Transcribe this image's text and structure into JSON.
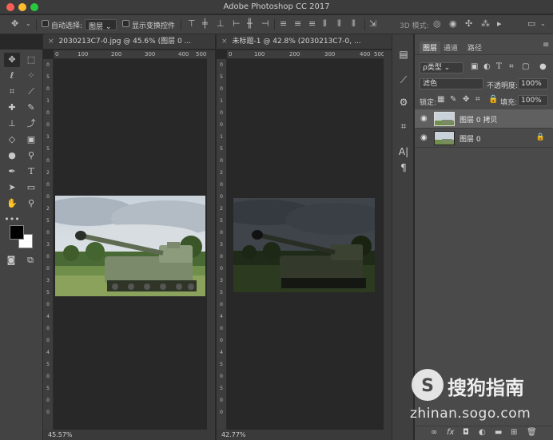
{
  "window": {
    "title": "Adobe Photoshop CC 2017"
  },
  "options_bar": {
    "auto_select_label": "自动选择:",
    "auto_select_value": "图层",
    "show_transform_label": "显示变换控件",
    "mode_3d_label": "3D 模式:"
  },
  "documents": [
    {
      "tab_label": "2030213C7-0.jpg @ 45.6% (图层 0 ...",
      "zoom": "45.57%",
      "ruler_h": [
        "0",
        "100",
        "200",
        "300",
        "400",
        "500"
      ],
      "ruler_v": [
        "0",
        "5",
        "0",
        "1",
        "0",
        "0",
        "1",
        "5",
        "0",
        "2",
        "0",
        "0",
        "2",
        "5",
        "0",
        "3",
        "0",
        "0",
        "3",
        "5",
        "0",
        "4",
        "0",
        "0",
        "4",
        "5",
        "0",
        "5",
        "0",
        "0"
      ]
    },
    {
      "tab_label": "未标题-1 @ 42.8% (2030213C7-0, ...",
      "zoom": "42.77%",
      "ruler_h": [
        "0",
        "100",
        "200",
        "300",
        "400",
        "500"
      ],
      "ruler_v": [
        "0",
        "5",
        "0",
        "1",
        "0",
        "0",
        "1",
        "5",
        "0",
        "2",
        "0",
        "0",
        "2",
        "5",
        "0",
        "3",
        "0",
        "0",
        "3",
        "5",
        "0",
        "4",
        "0",
        "0",
        "4",
        "5",
        "0",
        "5",
        "0",
        "0"
      ]
    }
  ],
  "layers_panel": {
    "tabs": [
      "图层",
      "通道",
      "路径"
    ],
    "filter_kind": "ρ类型",
    "blend_mode": "滤色",
    "opacity_label": "不透明度:",
    "opacity_value": "100%",
    "lock_label": "锁定:",
    "fill_label": "填充:",
    "fill_value": "100%",
    "layers": [
      {
        "name": "图层 0 拷贝",
        "visible": true,
        "selected": true,
        "locked": false
      },
      {
        "name": "图层 0",
        "visible": true,
        "selected": false,
        "locked": true
      }
    ]
  },
  "watermark": {
    "text": "搜狗指南",
    "url": "zhinan.sogo.com"
  },
  "colors": {
    "foreground": "#000000",
    "background": "#ffffff",
    "accent_selected": "#606060"
  }
}
